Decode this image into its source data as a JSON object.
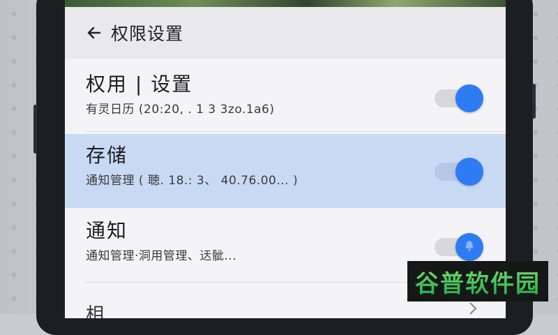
{
  "header": {
    "title": "权限设置",
    "back_icon": "arrow-left-icon"
  },
  "settings": [
    {
      "title": "权用 | 设置",
      "subtitle": "有灵日历 (20:20, . 1 3 3zo.1a6)",
      "enabled": true,
      "highlighted": false
    },
    {
      "title": "存储",
      "subtitle": "通知管理 ( 聴. 18.: 3、 40.76.00... )",
      "enabled": true,
      "highlighted": true
    },
    {
      "title": "通知",
      "subtitle": "通知管理·洞用管理、迗骴...",
      "enabled": true,
      "highlighted": false,
      "thumb_icon": "bell-icon"
    }
  ],
  "partial_row": {
    "title": "相"
  },
  "watermark": {
    "text": "谷普软件园"
  },
  "colors": {
    "accent": "#2f7cf2",
    "highlight": "#c8daf3"
  }
}
